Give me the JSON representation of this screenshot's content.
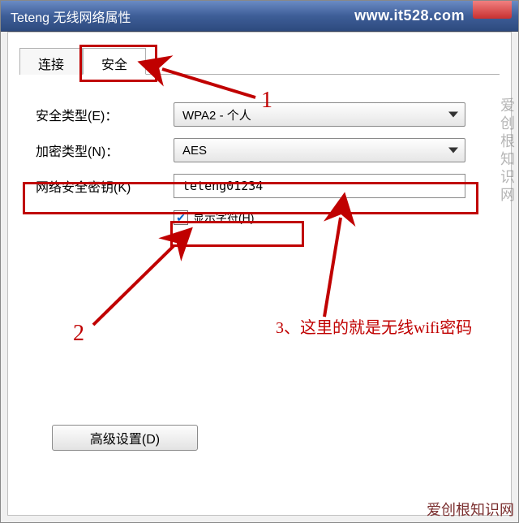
{
  "titlebar": {
    "title": "Teteng 无线网络属性",
    "url": "www.it528.com"
  },
  "tabs": {
    "connect": "连接",
    "security": "安全"
  },
  "fields": {
    "security_type_label": "安全类型(E)：",
    "security_type_value": "WPA2 - 个人",
    "encryption_label": "加密类型(N)：",
    "encryption_value": "AES",
    "key_label": "网络安全密钥(K)",
    "key_value": "teteng01234",
    "show_chars": "显示字符(H)"
  },
  "buttons": {
    "advanced": "高级设置(D)"
  },
  "annotations": {
    "n1": "1",
    "n2": "2",
    "n3": "3、这里的就是无线wifi密码"
  },
  "watermark": {
    "vertical": "爱创根知识网",
    "bottom": "爱创根知识网"
  }
}
